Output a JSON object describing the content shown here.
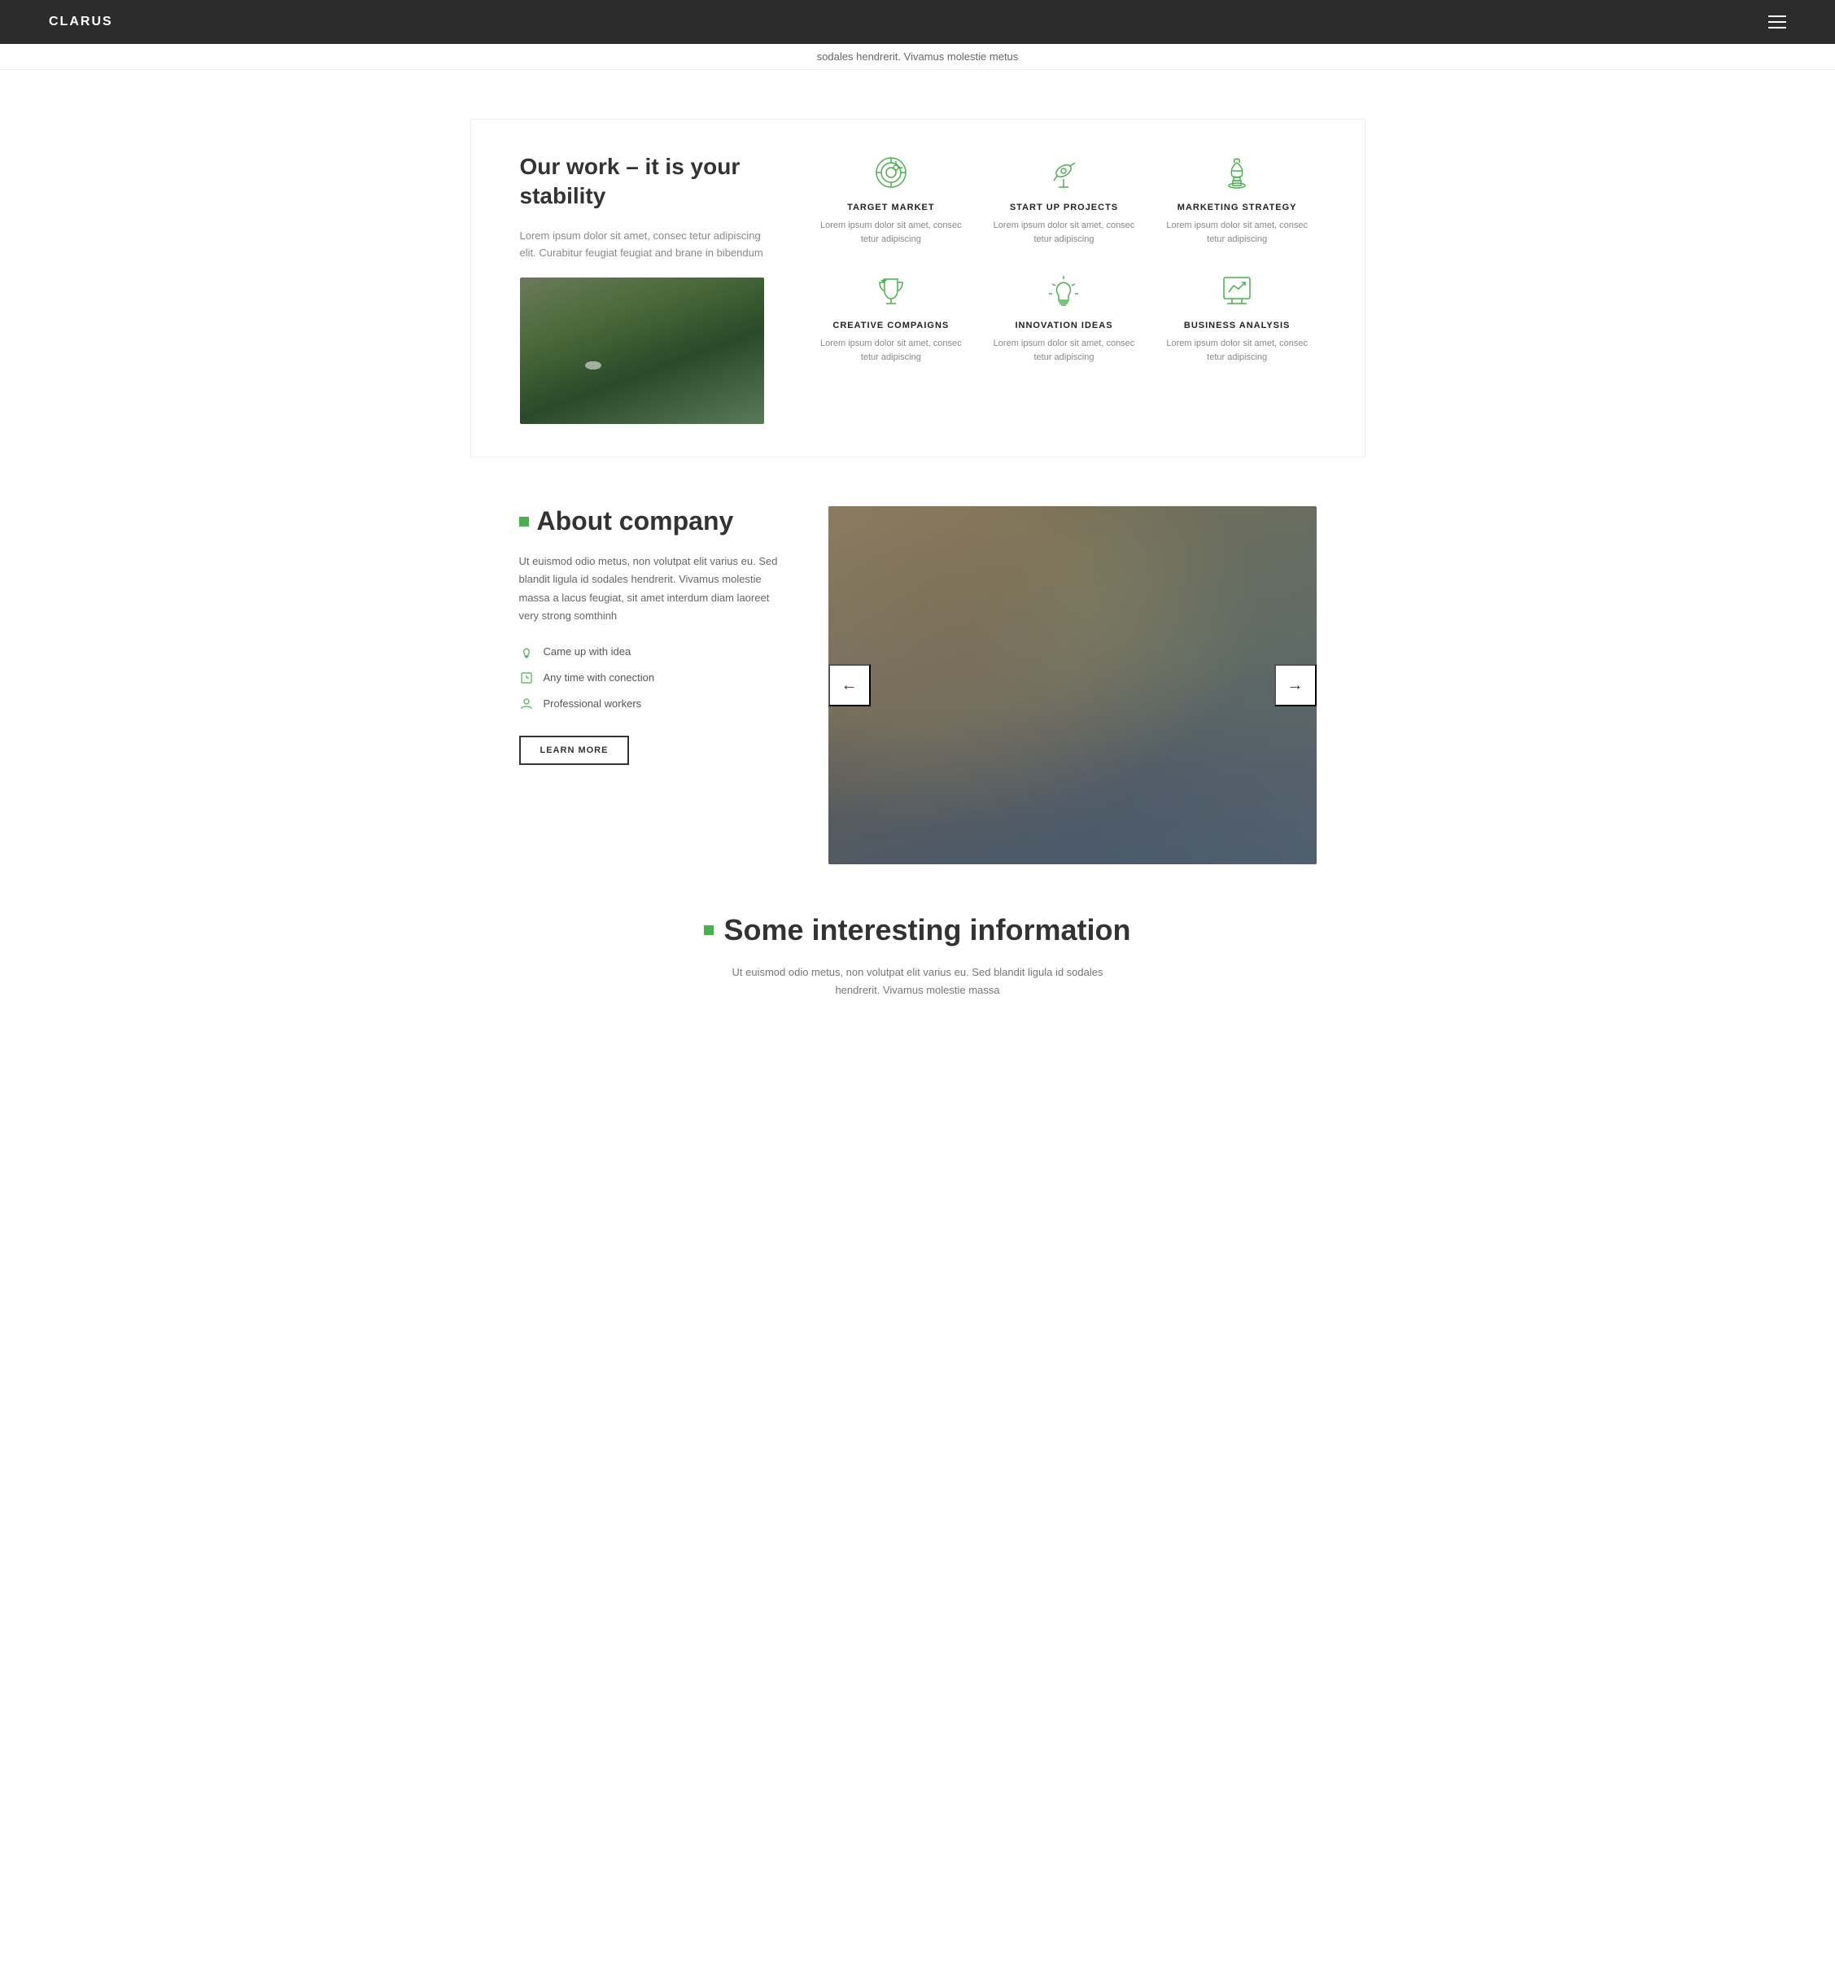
{
  "navbar": {
    "logo": "CLARUS",
    "menu_icon_label": "Menu"
  },
  "ticker": {
    "text": "sodales hendrerit. Vivamus molestie metus"
  },
  "section_work": {
    "title": "Our work – it is your stability",
    "description": "Lorem ipsum dolor sit amet, consec tetur adipiscing elit. Curabitur feugiat feugiat and brane in bibendum",
    "features": [
      {
        "icon": "target-icon",
        "title": "TARGET MARKET",
        "description": "Lorem ipsum dolor sit amet, consec tetur adipiscing"
      },
      {
        "icon": "telescope-icon",
        "title": "START UP PROJECTS",
        "description": "Lorem ipsum dolor sit amet, consec tetur adipiscing"
      },
      {
        "icon": "chess-icon",
        "title": "MARKETING STRATEGY",
        "description": "Lorem ipsum dolor sit amet, consec tetur adipiscing"
      },
      {
        "icon": "trophy-icon",
        "title": "CREATIVE COMPAIGNS",
        "description": "Lorem ipsum dolor sit amet, consec tetur adipiscing"
      },
      {
        "icon": "bulb-icon",
        "title": "INNOVATION IDEAS",
        "description": "Lorem ipsum dolor sit amet, consec tetur adipiscing"
      },
      {
        "icon": "chart-icon",
        "title": "BUSINESS ANALYSIS",
        "description": "Lorem ipsum dolor sit amet, consec tetur adipiscing"
      }
    ]
  },
  "section_about": {
    "title": "About company",
    "description": "Ut euismod odio metus, non volutpat elit varius eu. Sed blandit ligula id sodales hendrerit. Vivamus molestie massa a lacus feugiat, sit amet interdum diam laoreet very strong somthinh",
    "list": [
      {
        "icon": "lightbulb-icon",
        "text": "Came up with idea"
      },
      {
        "icon": "clock-icon",
        "text": "Any time with conection"
      },
      {
        "icon": "user-icon",
        "text": "Professional workers"
      }
    ],
    "button_label": "LEARN MORE",
    "slider_prev": "←",
    "slider_next": "→"
  },
  "section_info": {
    "title": "Some interesting information",
    "description": "Ut euismod odio metus, non volutpat elit varius eu. Sed blandit ligula id sodales hendrerit. Vivamus molestie massa"
  },
  "colors": {
    "green": "#4caf50",
    "dark": "#2c2c2c",
    "text_muted": "#888",
    "accent": "#4caf50"
  }
}
